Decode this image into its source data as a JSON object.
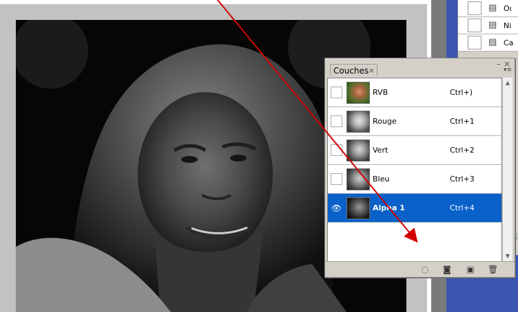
{
  "channels_panel": {
    "tab_label": "Couches",
    "tab_close": "×",
    "collapse_symbol": "–",
    "close_symbol": "×",
    "menu_symbol": "▾≡",
    "rows": [
      {
        "name": "RVB",
        "shortcut": "Ctrl+)",
        "visible": false,
        "selected": false,
        "thumb": "rgb"
      },
      {
        "name": "Rouge",
        "shortcut": "Ctrl+1",
        "visible": false,
        "selected": false,
        "thumb": "gray"
      },
      {
        "name": "Vert",
        "shortcut": "Ctrl+2",
        "visible": false,
        "selected": false,
        "thumb": "gray2"
      },
      {
        "name": "Bleu",
        "shortcut": "Ctrl+3",
        "visible": false,
        "selected": false,
        "thumb": "gray3"
      },
      {
        "name": "Alpha 1",
        "shortcut": "Ctrl+4",
        "visible": true,
        "selected": true,
        "thumb": "alpha"
      }
    ],
    "footer_icons": [
      "dotted-circle-icon",
      "mask-icon",
      "new-channel-icon",
      "trash-icon"
    ]
  },
  "right_panel": {
    "rows": [
      {
        "label": "Oı"
      },
      {
        "label": "Ni"
      },
      {
        "label": "Ca"
      }
    ],
    "bottom_symbol": "⊖⊖"
  },
  "arrow_color": "#d10000",
  "accent_color": "#0a61c9"
}
